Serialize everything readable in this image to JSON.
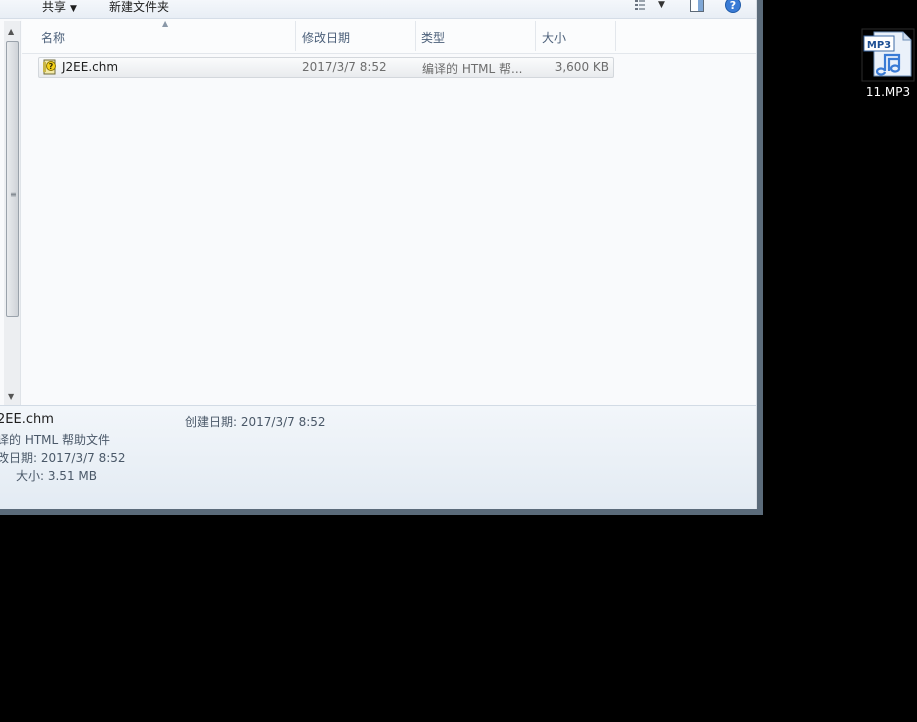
{
  "toolbar": {
    "share_label": "共享",
    "new_folder_label": "新建文件夹"
  },
  "columns": [
    "名称",
    "修改日期",
    "类型",
    "大小"
  ],
  "files": [
    {
      "name": "J2EE.chm",
      "modified": "2017/3/7 8:52",
      "type": "编译的 HTML 帮...",
      "size": "3,600 KB"
    }
  ],
  "details": {
    "title": "2EE.chm",
    "type": "译的 HTML 帮助文件",
    "modified": "改日期: 2017/3/7 8:52",
    "size": "大小: 3.51 MB",
    "created": "创建日期: 2017/3/7 8:52"
  },
  "desktop": {
    "icon_badge": "MP3",
    "icon_label": "11.MP3"
  },
  "colors": {
    "window_bg": "#f5f7fa",
    "desktop_bg": "#000000",
    "header_text": "#4c607a",
    "help_icon": "#3a7bd5"
  }
}
